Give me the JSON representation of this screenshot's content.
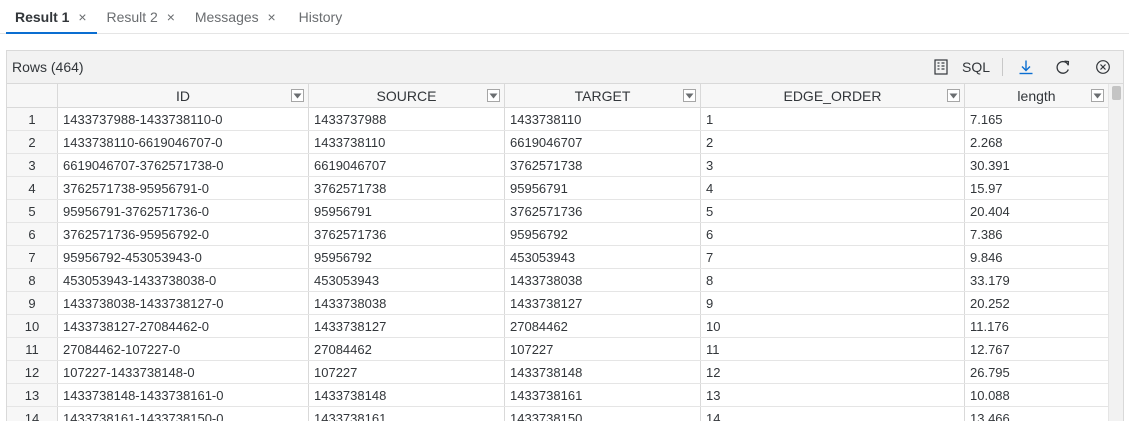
{
  "tabs": [
    {
      "label": "Result 1",
      "closable": true,
      "active": true
    },
    {
      "label": "Result 2",
      "closable": true,
      "active": false
    },
    {
      "label": "Messages",
      "closable": true,
      "active": false
    },
    {
      "label": "History",
      "closable": false,
      "active": false
    }
  ],
  "toolbar": {
    "rows_label": "Rows (464)",
    "sql_label": "SQL",
    "icons": [
      "column-settings-icon",
      "download-icon",
      "refresh-icon",
      "clear-filters-icon"
    ],
    "accent": "#0a6ed1"
  },
  "table": {
    "columns": [
      "",
      "ID",
      "SOURCE",
      "TARGET",
      "EDGE_ORDER",
      "length"
    ],
    "rows": [
      [
        "1",
        "1433737988-1433738110-0",
        "1433737988",
        "1433738110",
        "1",
        "7.165"
      ],
      [
        "2",
        "1433738110-6619046707-0",
        "1433738110",
        "6619046707",
        "2",
        "2.268"
      ],
      [
        "3",
        "6619046707-3762571738-0",
        "6619046707",
        "3762571738",
        "3",
        "30.391"
      ],
      [
        "4",
        "3762571738-95956791-0",
        "3762571738",
        "95956791",
        "4",
        "15.97"
      ],
      [
        "5",
        "95956791-3762571736-0",
        "95956791",
        "3762571736",
        "5",
        "20.404"
      ],
      [
        "6",
        "3762571736-95956792-0",
        "3762571736",
        "95956792",
        "6",
        "7.386"
      ],
      [
        "7",
        "95956792-453053943-0",
        "95956792",
        "453053943",
        "7",
        "9.846"
      ],
      [
        "8",
        "453053943-1433738038-0",
        "453053943",
        "1433738038",
        "8",
        "33.179"
      ],
      [
        "9",
        "1433738038-1433738127-0",
        "1433738038",
        "1433738127",
        "9",
        "20.252"
      ],
      [
        "10",
        "1433738127-27084462-0",
        "1433738127",
        "27084462",
        "10",
        "11.176"
      ],
      [
        "11",
        "27084462-107227-0",
        "27084462",
        "107227",
        "11",
        "12.767"
      ],
      [
        "12",
        "107227-1433738148-0",
        "107227",
        "1433738148",
        "12",
        "26.795"
      ],
      [
        "13",
        "1433738148-1433738161-0",
        "1433738148",
        "1433738161",
        "13",
        "10.088"
      ],
      [
        "14",
        "1433738161-1433738150-0",
        "1433738161",
        "1433738150",
        "14",
        "13.466"
      ]
    ]
  }
}
